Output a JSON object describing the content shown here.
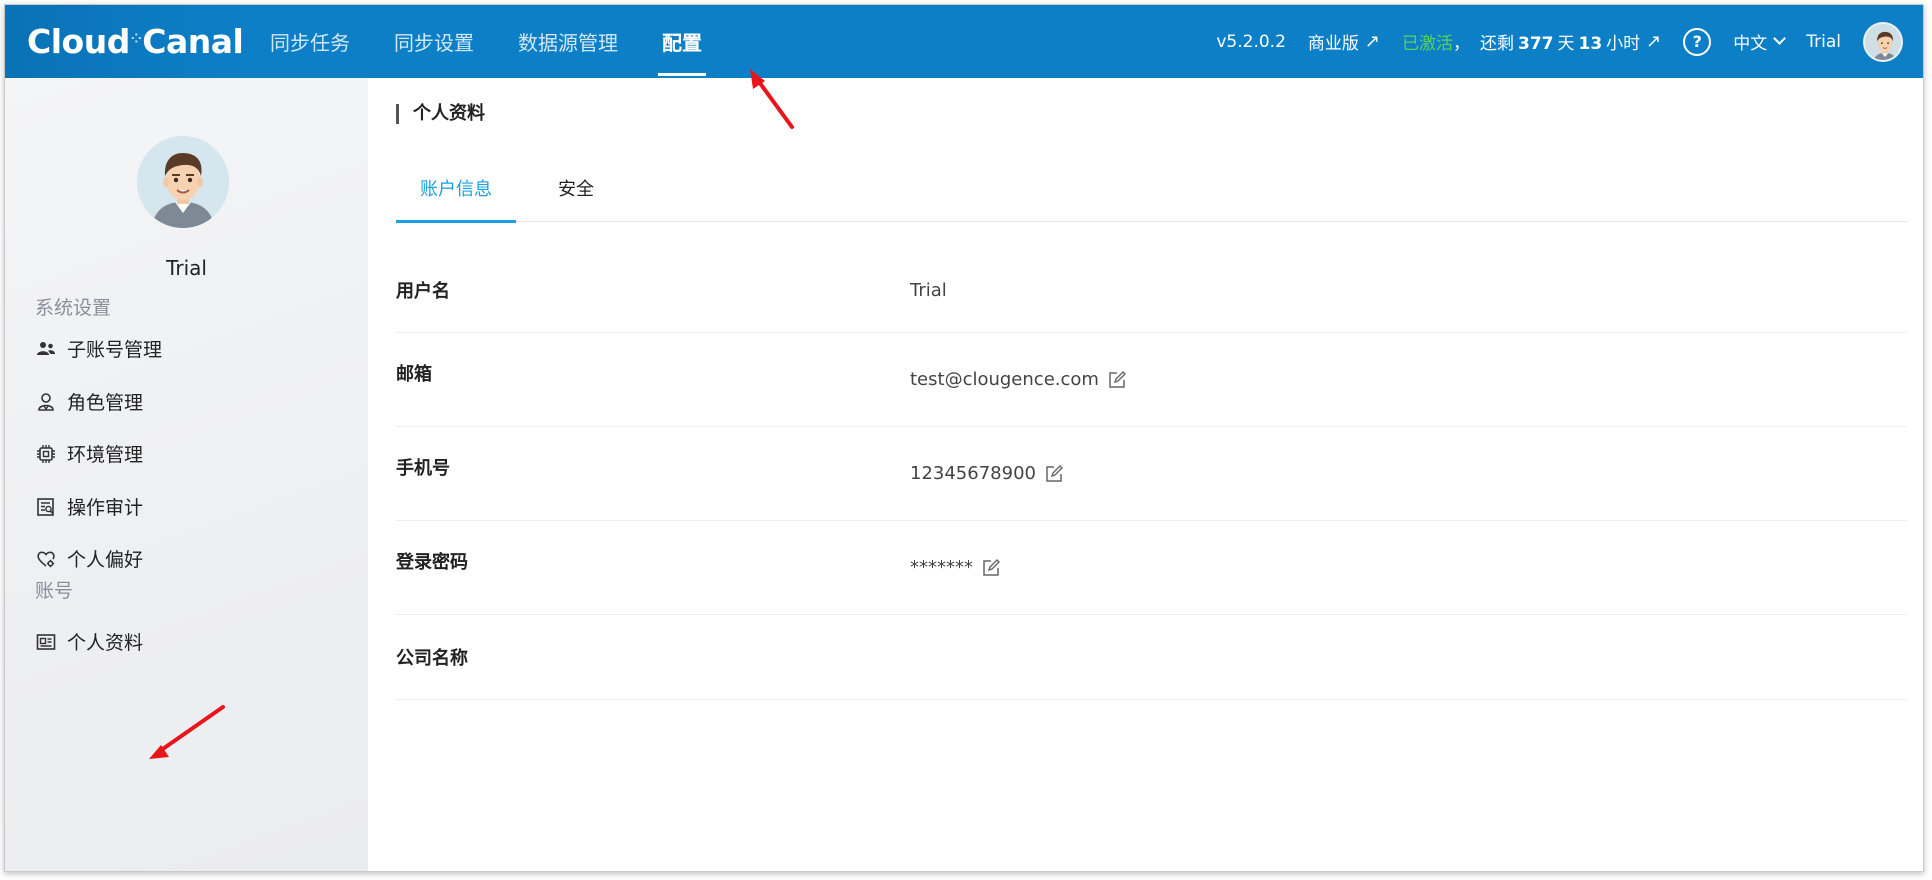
{
  "topbar": {
    "logo_part1": "Cloud",
    "logo_part2": "Canal",
    "nav": [
      {
        "label": "同步任务"
      },
      {
        "label": "同步设置"
      },
      {
        "label": "数据源管理"
      },
      {
        "label": "配置",
        "active": true
      }
    ],
    "version": "v5.2.0.2",
    "edition": "商业版",
    "activated": "已激活",
    "comma": "，",
    "remain_prefix": "还剩",
    "remain_days": "377",
    "days_unit": "天",
    "remain_hours": "13",
    "hours_unit": "小时",
    "help": "?",
    "language": "中文",
    "user": "Trial"
  },
  "sidebar": {
    "username": "Trial",
    "system_section": "系统设置",
    "system_items": [
      {
        "label": "子账号管理",
        "icon": "users-icon"
      },
      {
        "label": "角色管理",
        "icon": "role-icon"
      },
      {
        "label": "环境管理",
        "icon": "chip-icon"
      },
      {
        "label": "操作审计",
        "icon": "audit-icon"
      },
      {
        "label": "个人偏好",
        "icon": "heart-gear-icon"
      }
    ],
    "account_section": "账号",
    "account_items": [
      {
        "label": "个人资料",
        "icon": "id-card-icon"
      }
    ]
  },
  "main": {
    "title": "个人资料",
    "tabs": [
      {
        "label": "账户信息",
        "active": true
      },
      {
        "label": "安全"
      }
    ],
    "fields": [
      {
        "label": "用户名",
        "value": "Trial",
        "editable": false
      },
      {
        "label": "邮箱",
        "value": "test@clougence.com",
        "editable": true
      },
      {
        "label": "手机号",
        "value": "12345678900",
        "editable": true
      },
      {
        "label": "登录密码",
        "value": "*******",
        "editable": true
      },
      {
        "label": "公司名称",
        "value": "",
        "editable": false
      }
    ]
  },
  "colors": {
    "topbar": "#0d7fc7",
    "tab_active": "#1aa0e0",
    "activated": "#5bd35b",
    "annotation": "#e8161b"
  }
}
